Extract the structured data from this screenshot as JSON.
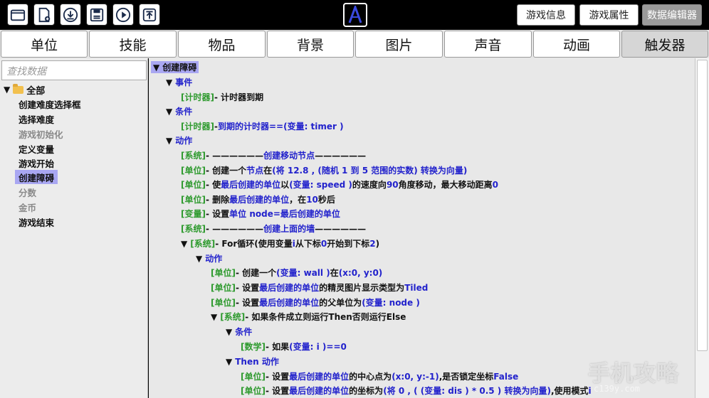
{
  "toolbar": {
    "icons": [
      "folder-open-icon",
      "new-file-icon",
      "download-icon",
      "save-icon",
      "play-icon",
      "upload-icon"
    ]
  },
  "top_right": {
    "game_info": "游戏信息",
    "game_props": "游戏属性",
    "data_editor": "数据编辑器"
  },
  "tabs": [
    "单位",
    "技能",
    "物品",
    "背景",
    "图片",
    "声音",
    "动画",
    "触发器"
  ],
  "active_tab": "触发器",
  "sidebar": {
    "search_placeholder": "查找数据",
    "root": "全部",
    "items": [
      "创建难度选择框",
      "选择难度",
      "游戏初始化",
      "定义变量",
      "游戏开始",
      "创建障碍",
      "分数",
      "金币",
      "游戏结束"
    ],
    "selected": "创建障碍"
  },
  "trigger": {
    "title": "创建障碍",
    "event_label": "事件",
    "event": {
      "tag": "[计时器]",
      "text": " - 计时器到期"
    },
    "cond_label": "条件",
    "cond": {
      "tag": "[计时器]",
      "pre": " - ",
      "a": "到期的计时器",
      "mid": "  ==  ",
      "b": "(变量: timer )"
    },
    "action_label": "动作",
    "a1": {
      "tag": "[系统]",
      "pre": " - ——————  ",
      "b": "创建移动节点",
      "post": "  ——————"
    },
    "a2": {
      "tag": "[单位]",
      "t1": " - 创建一个 ",
      "b1": "节点",
      "t2": " 在 ",
      "b2": "(将 12.8 , (随机 1 到 5 范围的实数) 转换为向量)"
    },
    "a3": {
      "tag": "[单位]",
      "t1": " - 使 ",
      "b1": "最后创建的单位",
      "t2": " 以 ",
      "b2": "(变量: speed )",
      "t3": " 的速度向 ",
      "b3": "90",
      "t4": " 角度移动，最大移动距离 ",
      "b4": "0"
    },
    "a4": {
      "tag": "[单位]",
      "t1": " - 删除 ",
      "b1": "最后创建的单位",
      "t2": " ，在 ",
      "b2": "10",
      "t3": " 秒后"
    },
    "a5": {
      "tag": "[变量]",
      "t1": " - 设置 ",
      "b1": "单位  node",
      "t2": "  =  ",
      "b2": "最后创建的单位"
    },
    "a6": {
      "tag": "[系统]",
      "pre": " - ——————  ",
      "b": "创建上面的墙",
      "post": "  ——————"
    },
    "loop": {
      "tag": "[系统]",
      "t1": " - For循环(使用变量 ",
      "b1": "i",
      "t2": " 从下标 ",
      "b2": "0",
      "t3": " 开始到下标 ",
      "b3": "2",
      "t4": " )"
    },
    "loop_action_label": "动作",
    "l1": {
      "tag": "[单位]",
      "t1": " - 创建一个 ",
      "b1": "(变量: wall )",
      "t2": " 在 ",
      "b2": "(x:0, y:0)"
    },
    "l2": {
      "tag": "[单位]",
      "t1": " - 设置 ",
      "b1": "最后创建的单位",
      "t2": " 的精灵图片显示类型为 ",
      "b2": "Tiled"
    },
    "l3": {
      "tag": "[单位]",
      "t1": " - 设置 ",
      "b1": "最后创建的单位",
      "t2": " 的父单位为 ",
      "b2": "(变量: node )"
    },
    "ifelse": {
      "tag": "[系统]",
      "text": " - 如果条件成立则运行Then否则运行Else"
    },
    "if_cond_label": "条件",
    "if_cond": {
      "tag": "[数学]",
      "t1": " - 如果 ",
      "b1": "(变量: i )",
      "t2": "  ==  ",
      "b2": "0"
    },
    "then_label": "Then 动作",
    "t1": {
      "tag": "[单位]",
      "t1": " - 设置 ",
      "b1": "最后创建的单位",
      "t2": " 的中心点为 ",
      "b2": "(x:0, y:-1)",
      "t3": " ,是否锁定坐标 ",
      "b3": "False"
    },
    "t2": {
      "tag": "[单位]",
      "t1": " - 设置 ",
      "b1": "最后创建的单位",
      "t2": " 的坐标为 ",
      "b2": "(将 0 , ( (变量: dis )  *  0.5 ) 转换为向量)",
      "t3": " ,使用模式 ",
      "b3": "i"
    }
  },
  "watermark": {
    "main": "手机攻略",
    "sub": "c139y.com"
  }
}
